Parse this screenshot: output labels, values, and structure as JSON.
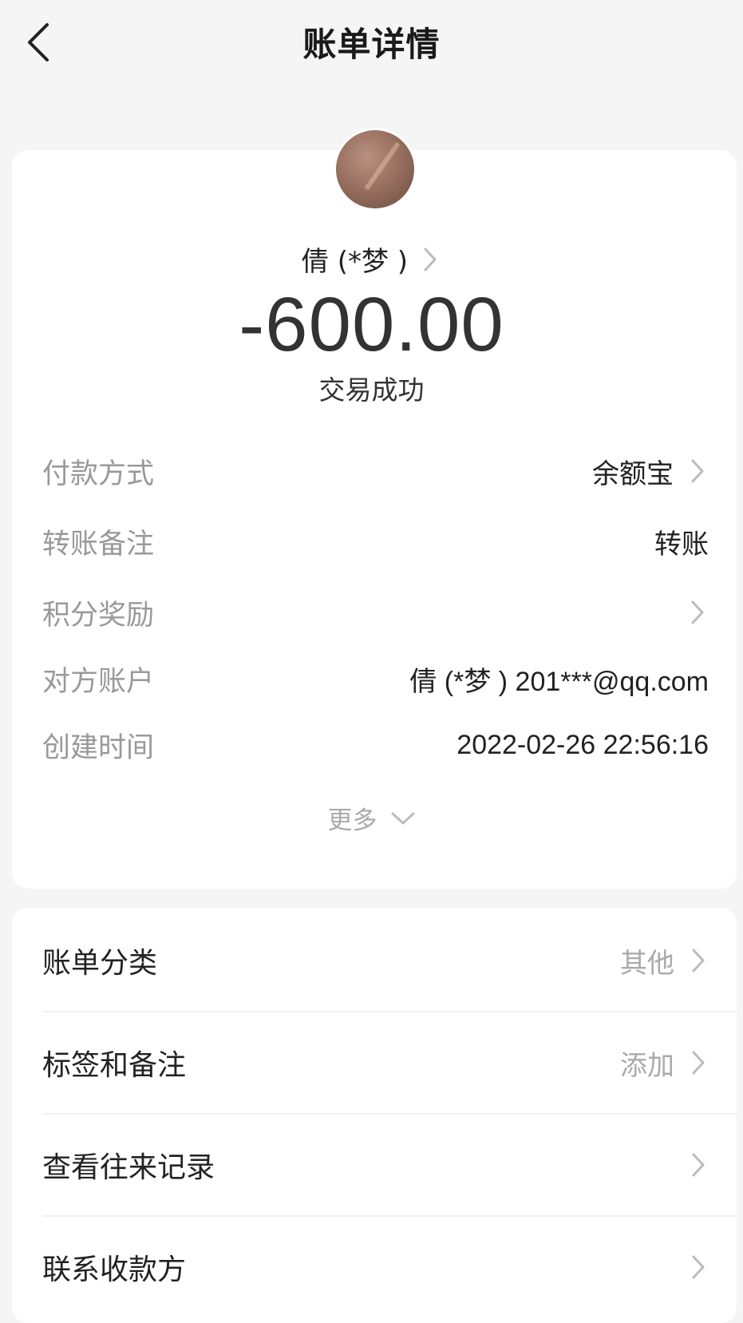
{
  "header": {
    "title": "账单详情",
    "back_icon": "chevron-left-icon"
  },
  "summary": {
    "payee": "倩 (*梦 )",
    "amount": "-600.00",
    "status": "交易成功"
  },
  "details": [
    {
      "label": "付款方式",
      "value": "余额宝",
      "chevron": true
    },
    {
      "label": "转账备注",
      "value": "转账",
      "chevron": false
    },
    {
      "label": "积分奖励",
      "value": "",
      "chevron": true
    },
    {
      "label": "对方账户",
      "value": "倩 (*梦 ) 201***@qq.com",
      "chevron": false
    },
    {
      "label": "创建时间",
      "value": "2022-02-26 22:56:16",
      "chevron": false
    }
  ],
  "more": {
    "label": "更多"
  },
  "actions": [
    {
      "label": "账单分类",
      "value": "其他"
    },
    {
      "label": "标签和备注",
      "value": "添加"
    },
    {
      "label": "查看往来记录",
      "value": ""
    },
    {
      "label": "联系收款方",
      "value": ""
    }
  ],
  "colors": {
    "background": "#f5f5f5",
    "card": "#ffffff",
    "label_gray": "#999999",
    "text_dark": "#222222"
  }
}
